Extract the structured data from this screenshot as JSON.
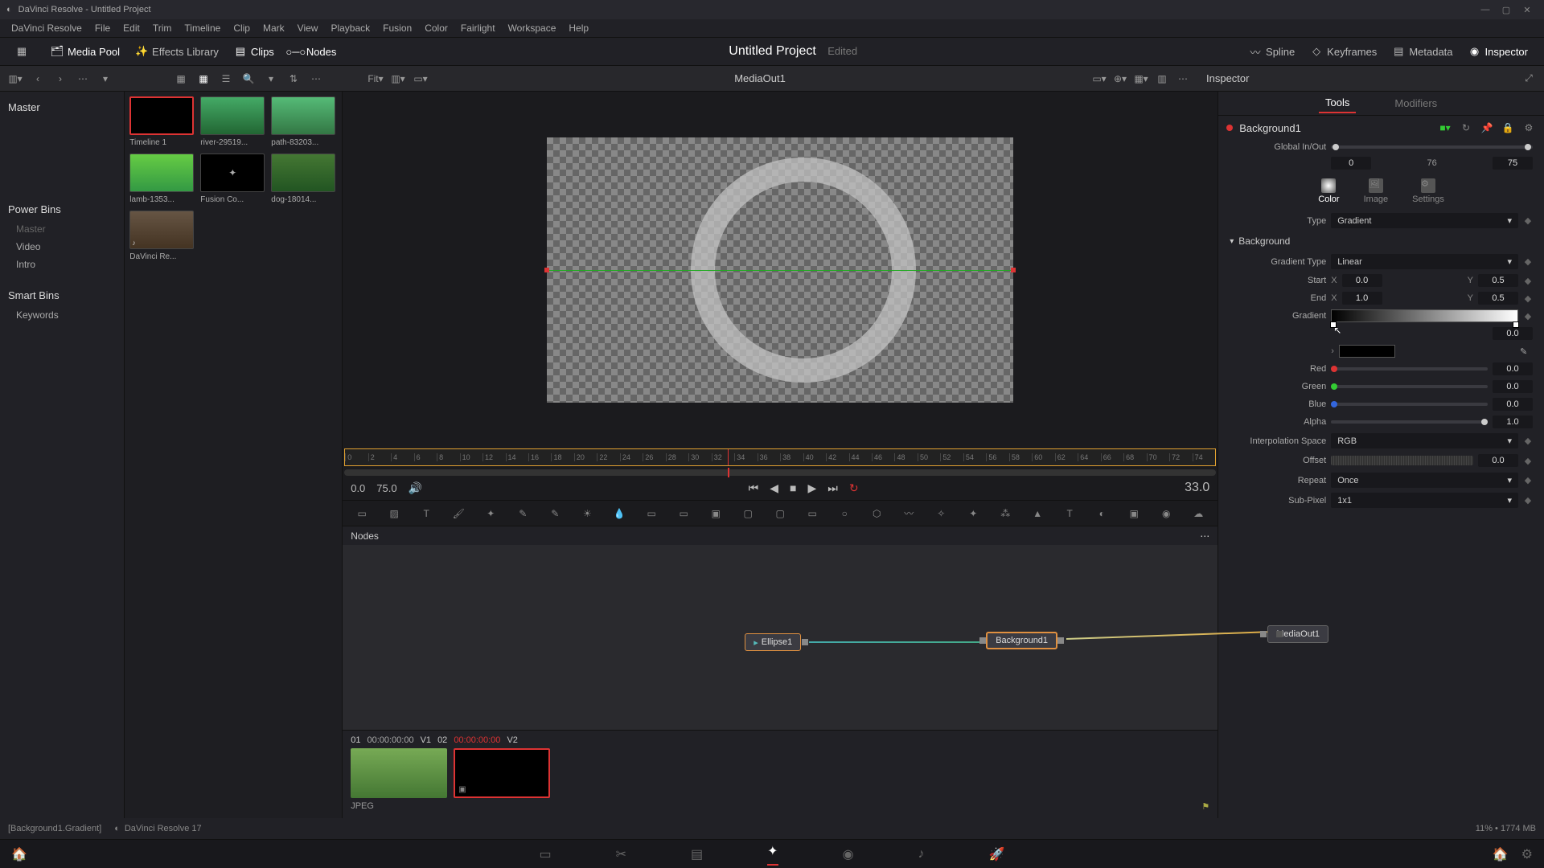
{
  "window": {
    "title": "DaVinci Resolve - Untitled Project"
  },
  "menubar": [
    "DaVinci Resolve",
    "File",
    "Edit",
    "Trim",
    "Timeline",
    "Clip",
    "Mark",
    "View",
    "Playback",
    "Fusion",
    "Color",
    "Fairlight",
    "Workspace",
    "Help"
  ],
  "toolbar": {
    "left": [
      {
        "icon": "media-pool-icon",
        "label": "Media Pool"
      },
      {
        "icon": "effects-icon",
        "label": "Effects Library"
      },
      {
        "icon": "clips-icon",
        "label": "Clips"
      },
      {
        "icon": "nodes-icon",
        "label": "Nodes"
      }
    ],
    "title": "Untitled Project",
    "edited": "Edited",
    "right": [
      {
        "icon": "spline-icon",
        "label": "Spline"
      },
      {
        "icon": "keyframes-icon",
        "label": "Keyframes"
      },
      {
        "icon": "metadata-icon",
        "label": "Metadata"
      },
      {
        "icon": "inspector-icon",
        "label": "Inspector",
        "active": true
      }
    ]
  },
  "subtoolbar": {
    "viewer_title": "MediaOut1",
    "fit": "Fit",
    "inspector": "Inspector"
  },
  "mediapool": {
    "master": "Master",
    "powerbins": "Power Bins",
    "bins": [
      "Master",
      "Video",
      "Intro"
    ],
    "smartbins": "Smart Bins",
    "smartitems": [
      "Keywords"
    ]
  },
  "clips": [
    {
      "name": "Timeline 1",
      "sel": true
    },
    {
      "name": "river-29519..."
    },
    {
      "name": "path-83203..."
    },
    {
      "name": "lamb-1353..."
    },
    {
      "name": "Fusion Co..."
    },
    {
      "name": "dog-18014..."
    },
    {
      "name": "DaVinci Re..."
    }
  ],
  "transport": {
    "start": "0.0",
    "end": "75.0",
    "current": "33.0"
  },
  "ruler": [
    "0",
    "2",
    "4",
    "6",
    "8",
    "10",
    "12",
    "14",
    "16",
    "18",
    "20",
    "22",
    "24",
    "26",
    "28",
    "30",
    "32",
    "34",
    "36",
    "38",
    "40",
    "42",
    "44",
    "46",
    "48",
    "50",
    "52",
    "54",
    "56",
    "58",
    "60",
    "62",
    "64",
    "66",
    "68",
    "70",
    "72",
    "74"
  ],
  "nodes": {
    "title": "Nodes",
    "n1": "Ellipse1",
    "n2": "Background1",
    "n3": "MediaOut1"
  },
  "clipstrip": {
    "items": [
      {
        "idx": "01",
        "tc": "00:00:00:00",
        "track": "V1"
      },
      {
        "idx": "02",
        "tc": "00:00:00:00",
        "track": "V2",
        "sel": true
      }
    ],
    "format": "JPEG"
  },
  "inspector": {
    "tabs": {
      "tools": "Tools",
      "modifiers": "Modifiers"
    },
    "node": "Background1",
    "global": {
      "label": "Global In/Out",
      "in": "0",
      "mid": "76",
      "out": "75"
    },
    "modes": {
      "color": "Color",
      "image": "Image",
      "settings": "Settings"
    },
    "type": {
      "label": "Type",
      "value": "Gradient"
    },
    "section": "Background",
    "gradtype": {
      "label": "Gradient Type",
      "value": "Linear"
    },
    "start": {
      "label": "Start",
      "xl": "X",
      "x": "0.0",
      "yl": "Y",
      "y": "0.5"
    },
    "end": {
      "label": "End",
      "xl": "X",
      "x": "1.0",
      "yl": "Y",
      "y": "0.5"
    },
    "gradient": {
      "label": "Gradient"
    },
    "pos": "0.0",
    "red": {
      "label": "Red",
      "val": "0.0"
    },
    "green": {
      "label": "Green",
      "val": "0.0"
    },
    "blue": {
      "label": "Blue",
      "val": "0.0"
    },
    "alpha": {
      "label": "Alpha",
      "val": "1.0"
    },
    "interp": {
      "label": "Interpolation Space",
      "value": "RGB"
    },
    "offset": {
      "label": "Offset",
      "val": "0.0"
    },
    "repeat": {
      "label": "Repeat",
      "value": "Once"
    },
    "subpixel": {
      "label": "Sub-Pixel",
      "value": "1x1"
    }
  },
  "status": {
    "context": "[Background1.Gradient]",
    "app": "DaVinci Resolve 17",
    "mem": "11% • 1774 MB"
  }
}
